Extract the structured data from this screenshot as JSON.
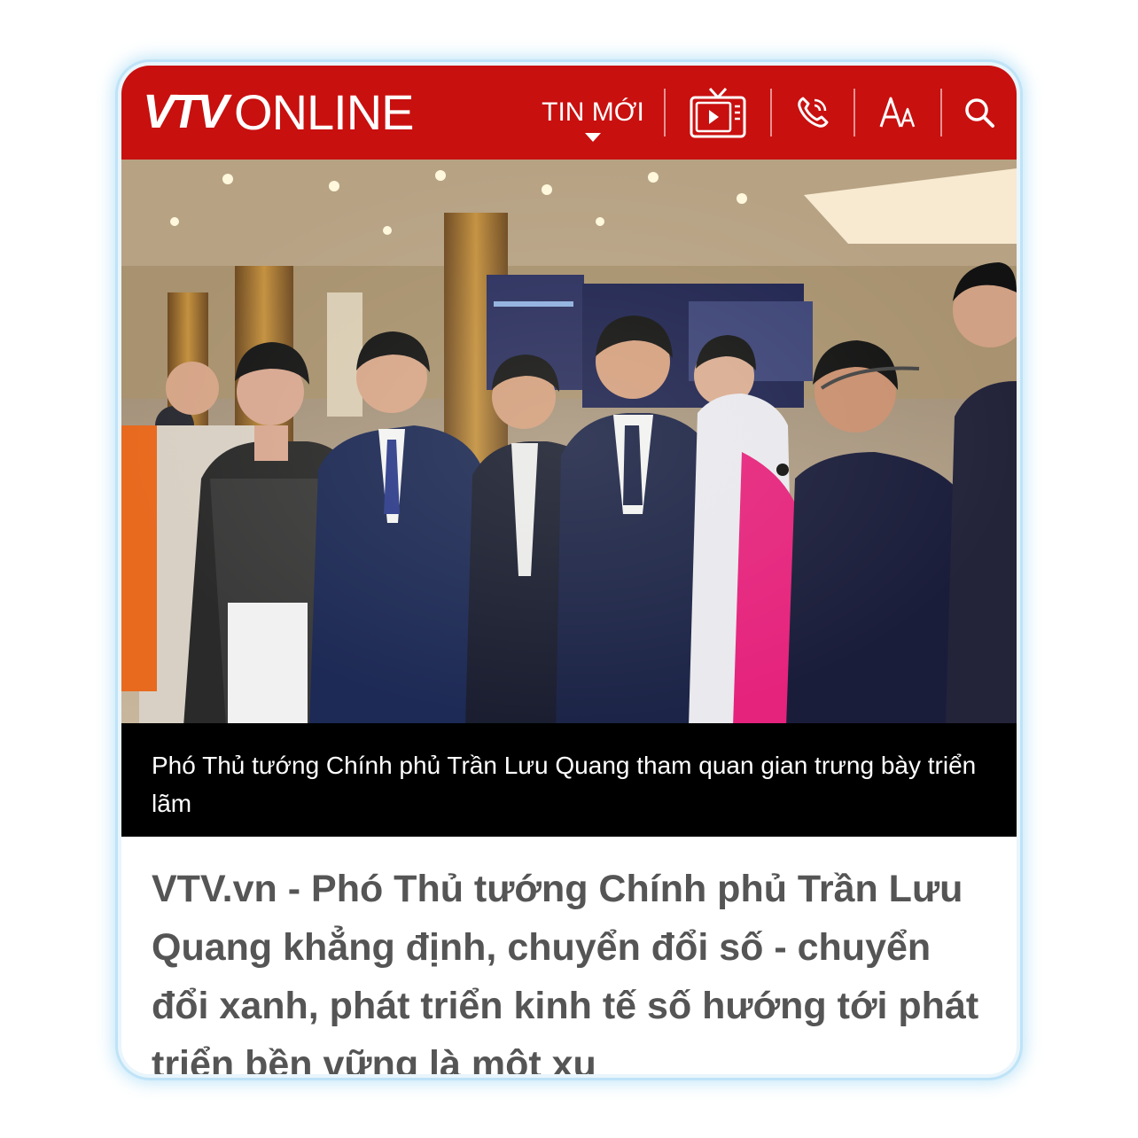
{
  "header": {
    "logo_vtv": "VTV",
    "logo_online": "ONLINE",
    "nav_tin_moi": "TIN MỚI",
    "font_icon_text": "AA"
  },
  "icons": [
    "tv-icon",
    "phone-icon",
    "font-size-icon",
    "search-icon"
  ],
  "colors": {
    "brand_red": "#c8100f",
    "caption_bg": "#000000",
    "lead_text": "#555555"
  },
  "article": {
    "photo_caption": "Phó Thủ tướng Chính phủ Trần Lưu Quang tham quan gian trưng bày triển lãm",
    "lead": "VTV.vn - Phó Thủ tướng Chính phủ Trần Lưu Quang khẳng định, chuyển đổi số - chuyển đổi xanh, phát triển kinh tế số hướng tới phát triển bền vững là một xu"
  }
}
